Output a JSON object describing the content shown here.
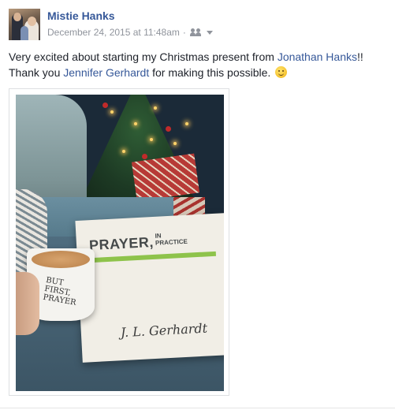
{
  "post": {
    "author": "Mistie Hanks",
    "timestamp": "December 24, 2015 at 11:48am",
    "separator": "·",
    "audience_icon": "friends-icon",
    "menu_icon": "chevron-down-icon",
    "text": {
      "part1": "Very excited about starting my Christmas present from ",
      "link1": "Jonathan Hanks",
      "part2": "!! Thank you ",
      "link2": "Jennifer Gerhardt",
      "part3": " for making this possible. ",
      "emoji": "smiley-emoji"
    },
    "photo": {
      "book_title": "PRAYER,",
      "book_subtitle_line1": "IN",
      "book_subtitle_line2": "PRACTICE",
      "book_author": "J. L. Gerhardt",
      "mug_text_line1": "BUT",
      "mug_text_line2": "FIRST,",
      "mug_text_line3": "PRAYER"
    }
  },
  "colors": {
    "link": "#365899",
    "meta": "#90949c",
    "text": "#1d2129"
  }
}
